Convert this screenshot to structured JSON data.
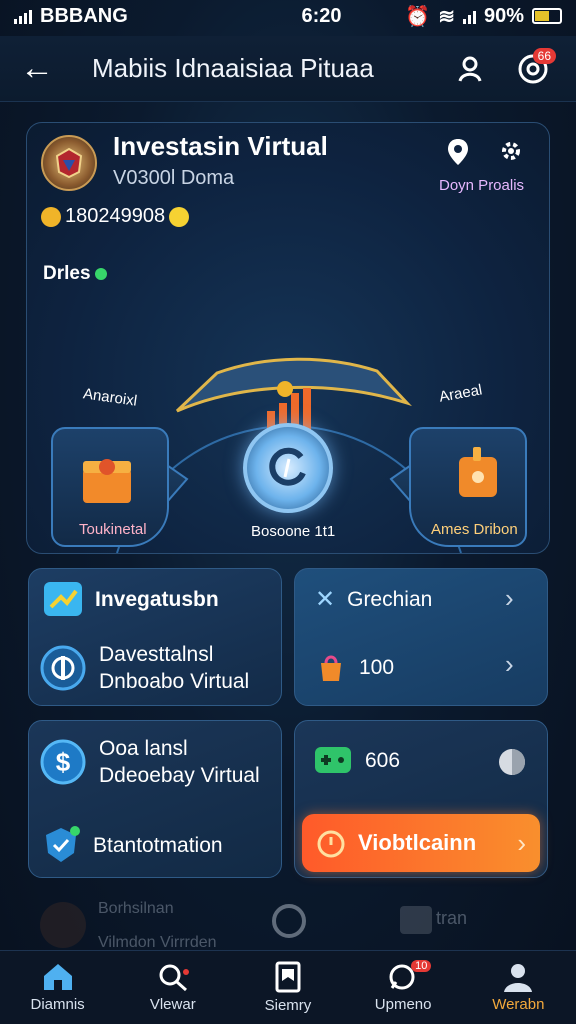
{
  "status_bar": {
    "carrier": "BBBANG",
    "time": "6:20",
    "battery": "90%"
  },
  "header": {
    "title": "Mabiis Idnaaisiaa Pituaa",
    "notification_count": "66"
  },
  "profile": {
    "title": "Investasin Virtual",
    "subtitle": "V0300l Doma",
    "balance": "180249908",
    "deploy_label": "Doyn Proalis"
  },
  "wheel": {
    "drives_label": "Drles",
    "segments": [
      {
        "label": "Anaroixl"
      },
      {
        "label": "Araeal"
      },
      {
        "label": "Toukinetal"
      },
      {
        "label": "Bosoone 1t1"
      },
      {
        "label": "Ames Dribon"
      }
    ]
  },
  "tiles": {
    "invest": {
      "title": "Invegatusbn",
      "line1": "Davesttalnsl",
      "line2": "Dnboabo Virtual"
    },
    "grechan": {
      "title": "Grechian",
      "value": "100"
    },
    "dollar": {
      "line1": "Ooa lansl",
      "line2": "Ddeoebay Virtual",
      "extra": "Btantotmation"
    },
    "game": {
      "value": "606",
      "cta": "Viobtlcainn"
    }
  },
  "ghost": {
    "text1": "Borhsilnan",
    "text2": "Vilmdon Virrrden",
    "text3": "tran"
  },
  "nav": {
    "items": [
      {
        "label": "Diamnis"
      },
      {
        "label": "Vlewar"
      },
      {
        "label": "Siemry"
      },
      {
        "label": "Upmeno"
      },
      {
        "label": "Werabn"
      }
    ],
    "badge": "10"
  },
  "colors": {
    "accent": "#f3a93c",
    "cta_start": "#ff5a2a",
    "cta_end": "#f98f2d",
    "card_border": "#2a4d73"
  }
}
